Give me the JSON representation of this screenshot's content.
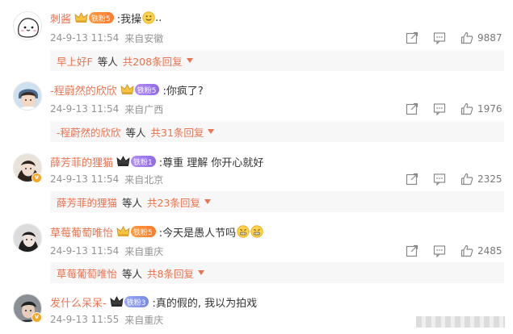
{
  "comments": [
    {
      "username": "刺酱",
      "badge": "铁粉5",
      "badge_color": "#ff8a34",
      "text": ":我操",
      "trail": "..",
      "emoji": [
        "smile-emoji"
      ],
      "time": "24-9-13 11:54",
      "source": "来自安徽",
      "likes": "9887",
      "reply": {
        "user": "早上好F",
        "middle": "等人",
        "count": "共208条回复"
      }
    },
    {
      "username": "-程蔚然的欣欣",
      "badge": "铁粉5",
      "badge_color": "#9b7cf0",
      "text": ":你疯了?",
      "trail": "",
      "emoji": [],
      "time": "24-9-13 11:54",
      "source": "来自广西",
      "likes": "1976",
      "reply": {
        "user": "-程蔚然的欣欣",
        "middle": "等人",
        "count": "共31条回复"
      }
    },
    {
      "username": "薛芳菲的狸猫",
      "badge": "铁粉1",
      "badge_color": "#9b7cf0",
      "text": ":尊重 理解 你开心就好",
      "trail": "",
      "emoji": [],
      "time": "24-9-13 11:54",
      "source": "来自北京",
      "likes": "2325",
      "reply": {
        "user": "薛芳菲的狸猫",
        "middle": "等人",
        "count": "共23条回复"
      }
    },
    {
      "username": "草莓葡萄唯怡",
      "badge": "铁粉5",
      "badge_color": "#ff8a34",
      "text": ":今天是愚人节吗",
      "trail": "",
      "emoji": [
        "grimace-emoji",
        "grimace-emoji"
      ],
      "time": "24-9-13 11:54",
      "source": "来自重庆",
      "likes": "2485",
      "reply": {
        "user": "草莓葡萄唯怡",
        "middle": "等人",
        "count": "共8条回复"
      }
    },
    {
      "username": "发什么呆呆-",
      "badge": "铁粉3",
      "badge_color": "#8093e8",
      "text": ":真的假的, 我以为拍戏",
      "trail": "",
      "emoji": [],
      "time": "24-9-13 11:55",
      "source": "来自重庆",
      "likes": "",
      "reply": null
    }
  ],
  "icons": {
    "share": "share-icon",
    "comment": "comment-icon",
    "like": "thumbs-up-icon",
    "expand": "caret-down-icon",
    "crown": "crown-icon",
    "verified": "verified-v-icon"
  },
  "colors": {
    "username": "#eb7350",
    "meta": "#939393",
    "reply_bg": "#f7f7f7"
  }
}
